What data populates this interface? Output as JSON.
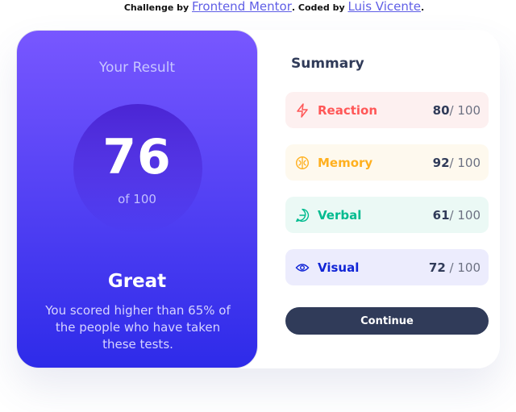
{
  "attribution": {
    "challenge_prefix": "Challenge by ",
    "challenge_link": "Frontend Mentor",
    "coded_prefix": ". Coded by ",
    "coded_link": "Luis Vicente",
    "suffix": "."
  },
  "result": {
    "title": "Your Result",
    "score": "76",
    "of_total": "of 100",
    "grade": "Great",
    "description": "You scored higher than 65% of the people who have taken these tests."
  },
  "summary": {
    "title": "Summary",
    "items": [
      {
        "icon": "lightning-icon",
        "label": "Reaction",
        "score": "80",
        "max": "/ 100",
        "color": "#ff5757"
      },
      {
        "icon": "brain-icon",
        "label": "Memory",
        "score": "92",
        "max": "/ 100",
        "color": "#ffb01f"
      },
      {
        "icon": "speech-bubble-icon",
        "label": "Verbal",
        "score": "61",
        "max": "/ 100",
        "color": "#00bb8f"
      },
      {
        "icon": "eye-icon",
        "label": "Visual",
        "score": "72",
        "max": " / 100",
        "color": "#1125d6"
      }
    ],
    "continue_label": "Continue"
  },
  "colors": {
    "gradient_top": "#7857ff",
    "gradient_bottom": "#2e2be9",
    "button": "#303b59"
  }
}
